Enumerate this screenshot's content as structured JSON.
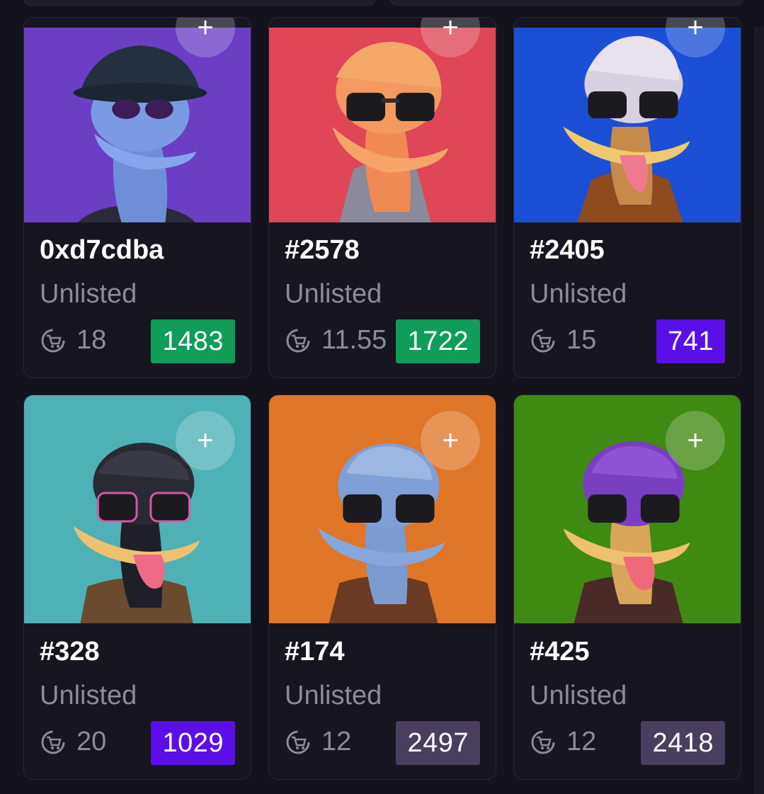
{
  "colors": {
    "badge_green": "#0f9d58",
    "badge_purple": "#5b0fe8",
    "badge_dark": "#4a3e5e"
  },
  "cards": [
    {
      "title": "0xd7cdba",
      "status": "Unlisted",
      "price": "18",
      "rank": "1483",
      "rank_color": "#0f9d58",
      "bg": "#6a3fc4",
      "add_label": "+"
    },
    {
      "title": "#2578",
      "status": "Unlisted",
      "price": "11.55",
      "rank": "1722",
      "rank_color": "#0f9d58",
      "bg": "#df4656",
      "add_label": "+"
    },
    {
      "title": "#2405",
      "status": "Unlisted",
      "price": "15",
      "rank": "741",
      "rank_color": "#5b0fe8",
      "bg": "#1b4fd6",
      "add_label": "+"
    },
    {
      "title": "#328",
      "status": "Unlisted",
      "price": "20",
      "rank": "1029",
      "rank_color": "#5b0fe8",
      "bg": "#4eb1b5",
      "add_label": "+"
    },
    {
      "title": "#174",
      "status": "Unlisted",
      "price": "12",
      "rank": "2497",
      "rank_color": "#4a3e5e",
      "bg": "#e07628",
      "add_label": "+"
    },
    {
      "title": "#425",
      "status": "Unlisted",
      "price": "12",
      "rank": "2418",
      "rank_color": "#4a3e5e",
      "bg": "#3f8a12",
      "add_label": "+"
    }
  ]
}
